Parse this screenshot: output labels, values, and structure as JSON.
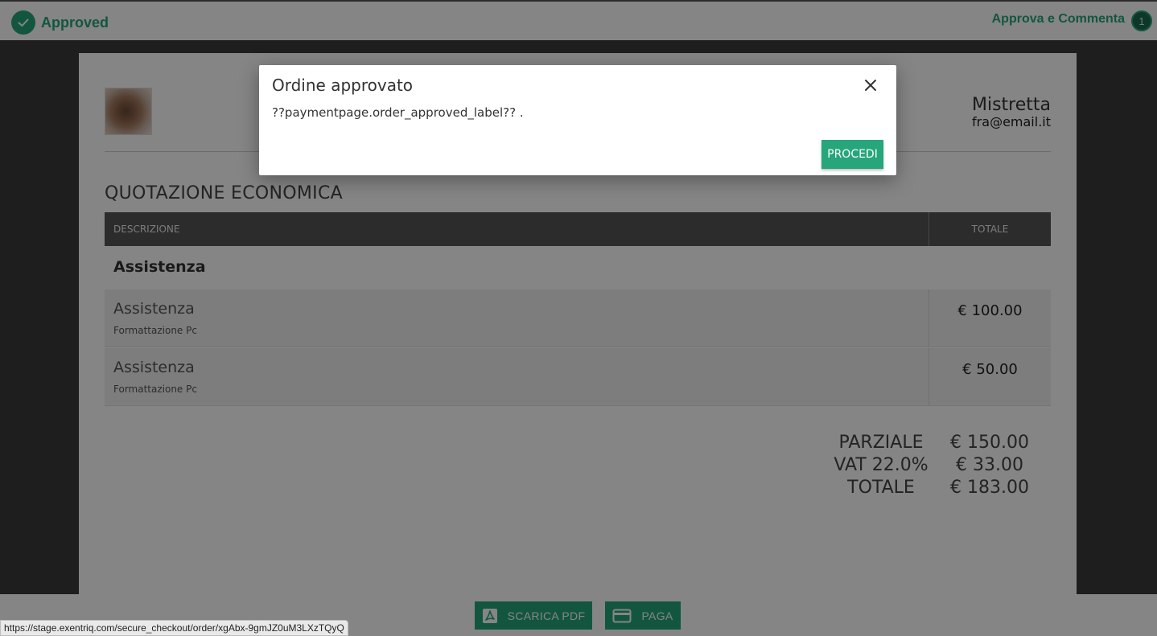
{
  "header": {
    "status_label": "Approved",
    "approve_comment_label": "Approva e Commenta",
    "comment_count": "1"
  },
  "document": {
    "client_name": "Mistretta",
    "client_email": "fra@email.it",
    "section_title": "QUOTAZIONE ECONOMICA",
    "table": {
      "columns": [
        "DESCRIZIONE",
        "TOTALE"
      ],
      "group_title": "Assistenza",
      "rows": [
        {
          "name": "Assistenza",
          "description": "Formattazione Pc",
          "price": "€ 100.00"
        },
        {
          "name": "Assistenza",
          "description": "Formattazione Pc",
          "price": "€ 50.00"
        }
      ]
    },
    "totals": {
      "partial_label": "PARZIALE",
      "partial_value": "€ 150.00",
      "vat_label": "VAT 22.0%",
      "vat_value": "€ 33.00",
      "total_label": "TOTALE",
      "total_value": "€ 183.00"
    }
  },
  "footer": {
    "pdf_button_label": "SCARICA PDF",
    "pay_button_label": "PAGA"
  },
  "status_url": "https://stage.exentriq.com/secure_checkout/order/xgAbx-9gmJZ0uM3LXzTQyQ",
  "modal": {
    "title": "Ordine approvato",
    "message": "??paymentpage.order_approved_label?? .",
    "proceed_label": "PROCEDI"
  },
  "colors": {
    "accent": "#26a67a",
    "table_header": "#555555"
  }
}
